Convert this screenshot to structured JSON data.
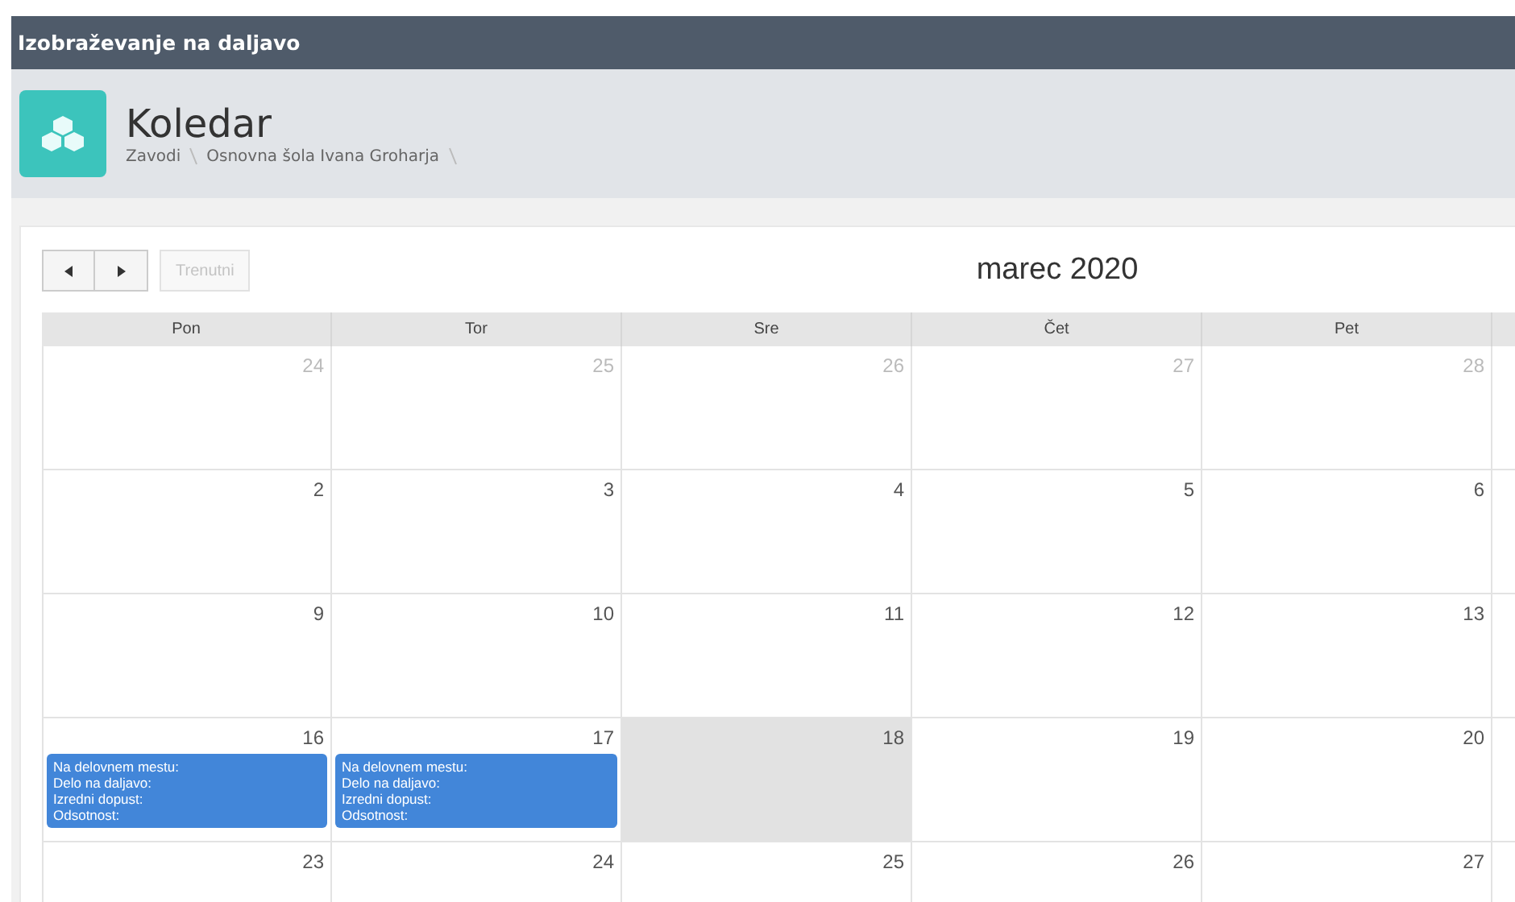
{
  "app_bar": {
    "title": "Izobraževanje na daljavo"
  },
  "page_header": {
    "title": "Koledar",
    "breadcrumbs": [
      "Zavodi",
      "Osnovna šola Ivana Groharja"
    ]
  },
  "toolbar": {
    "today_button": {
      "label": "Trenutni",
      "disabled": true
    },
    "title": "marec 2020"
  },
  "weekdays": [
    "Pon",
    "Tor",
    "Sre",
    "Čet",
    "Pet"
  ],
  "weeks": [
    {
      "days": [
        {
          "day": "24",
          "other_month": true,
          "today": false
        },
        {
          "day": "25",
          "other_month": true,
          "today": false
        },
        {
          "day": "26",
          "other_month": true,
          "today": false
        },
        {
          "day": "27",
          "other_month": true,
          "today": false
        },
        {
          "day": "28",
          "other_month": true,
          "today": false
        }
      ]
    },
    {
      "days": [
        {
          "day": "2",
          "other_month": false,
          "today": false
        },
        {
          "day": "3",
          "other_month": false,
          "today": false
        },
        {
          "day": "4",
          "other_month": false,
          "today": false
        },
        {
          "day": "5",
          "other_month": false,
          "today": false
        },
        {
          "day": "6",
          "other_month": false,
          "today": false
        }
      ]
    },
    {
      "days": [
        {
          "day": "9",
          "other_month": false,
          "today": false
        },
        {
          "day": "10",
          "other_month": false,
          "today": false
        },
        {
          "day": "11",
          "other_month": false,
          "today": false
        },
        {
          "day": "12",
          "other_month": false,
          "today": false
        },
        {
          "day": "13",
          "other_month": false,
          "today": false
        }
      ]
    },
    {
      "days": [
        {
          "day": "16",
          "other_month": false,
          "today": false,
          "events": [
            {
              "lines": [
                "Na delovnem mestu:",
                "Delo na daljavo:",
                "Izredni dopust:",
                "Odsotnost:"
              ]
            }
          ]
        },
        {
          "day": "17",
          "other_month": false,
          "today": false,
          "events": [
            {
              "lines": [
                "Na delovnem mestu:",
                "Delo na daljavo:",
                "Izredni dopust:",
                "Odsotnost:"
              ]
            }
          ]
        },
        {
          "day": "18",
          "other_month": false,
          "today": true
        },
        {
          "day": "19",
          "other_month": false,
          "today": false
        },
        {
          "day": "20",
          "other_month": false,
          "today": false
        }
      ]
    },
    {
      "days": [
        {
          "day": "23",
          "other_month": false,
          "today": false
        },
        {
          "day": "24",
          "other_month": false,
          "today": false
        },
        {
          "day": "25",
          "other_month": false,
          "today": false
        },
        {
          "day": "26",
          "other_month": false,
          "today": false
        },
        {
          "day": "27",
          "other_month": false,
          "today": false
        }
      ]
    }
  ]
}
